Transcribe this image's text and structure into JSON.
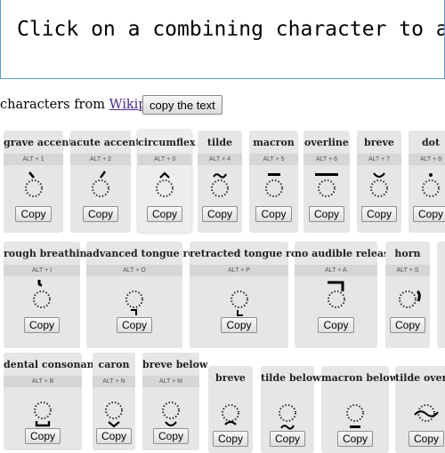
{
  "editor": {
    "text": "Click on a combining character to add it!"
  },
  "credit": {
    "prefix": "characters from ",
    "link": "Wikipedia",
    "suffix": ";"
  },
  "copy_text_button": "copy the text",
  "copy_label": "Copy",
  "cards": [
    {
      "title": "grave accent",
      "shortcut": "ALT + 1",
      "icon": "grave-accent-glyph"
    },
    {
      "title": "acute accent",
      "shortcut": "ALT + 2",
      "icon": "acute-accent-glyph"
    },
    {
      "title": "circumflex",
      "shortcut": "ALT + 3",
      "icon": "circumflex-glyph"
    },
    {
      "title": "tilde",
      "shortcut": "ALT + 4",
      "icon": "tilde-glyph"
    },
    {
      "title": "macron",
      "shortcut": "ALT + 5",
      "icon": "macron-glyph"
    },
    {
      "title": "overline",
      "shortcut": "ALT + 6",
      "icon": "overline-glyph"
    },
    {
      "title": "breve",
      "shortcut": "ALT + 7",
      "icon": "breve-glyph"
    },
    {
      "title": "dot",
      "shortcut": "ALT + 8",
      "icon": "dot-above-glyph"
    },
    {
      "title": "rough breathing",
      "shortcut": "ALT + I",
      "icon": "rough-breathing-glyph"
    },
    {
      "title": "advanced tongue root",
      "shortcut": "ALT + O",
      "icon": "advanced-tongue-root-glyph"
    },
    {
      "title": "retracted tongue root",
      "shortcut": "ALT + P",
      "icon": "retracted-tongue-root-glyph"
    },
    {
      "title": "no audible release",
      "shortcut": "ALT + A",
      "icon": "no-audible-release-glyph"
    },
    {
      "title": "horn",
      "shortcut": "ALT + S",
      "icon": "horn-glyph"
    },
    {
      "title": "",
      "shortcut": "",
      "icon": ""
    },
    {
      "title": "dental consonant",
      "shortcut": "ALT + B",
      "icon": "dental-consonant-glyph"
    },
    {
      "title": "caron",
      "shortcut": "ALT + N",
      "icon": "caron-glyph"
    },
    {
      "title": "breve below",
      "shortcut": "ALT + M",
      "icon": "breve-below-glyph"
    },
    {
      "title": "breve",
      "shortcut": "",
      "icon": "breve-glyph"
    },
    {
      "title": "tilde below",
      "shortcut": "",
      "icon": "tilde-below-glyph"
    },
    {
      "title": "macron below",
      "shortcut": "",
      "icon": "macron-below-glyph"
    },
    {
      "title": "tilde overlay",
      "shortcut": "",
      "icon": "tilde-overlay-glyph"
    }
  ]
}
